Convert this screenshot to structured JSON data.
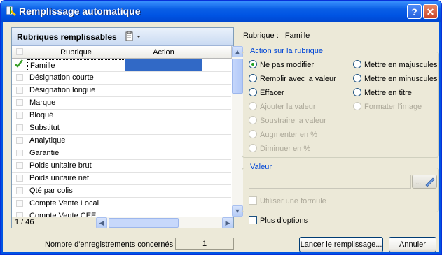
{
  "window": {
    "title": "Remplissage automatique",
    "help_label": "?",
    "close_label": "✕"
  },
  "grid": {
    "title": "Rubriques remplissables",
    "col_rubrique": "Rubrique",
    "col_action": "Action",
    "rows": [
      "Famille",
      "Désignation courte",
      "Désignation longue",
      "Marque",
      "Bloqué",
      "Substitut",
      "Analytique",
      "Garantie",
      "Poids unitaire brut",
      "Poids unitaire net",
      "Qté par colis",
      "Compte Vente Local",
      "Compte Vente CEE"
    ],
    "selected_index": 0,
    "pager": "1 / 46"
  },
  "rubrique": {
    "label": "Rubrique :",
    "value": "Famille"
  },
  "action": {
    "legend": "Action sur la rubrique",
    "ne_pas_modifier": "Ne pas modifier",
    "remplir": "Remplir avec la valeur",
    "effacer": "Effacer",
    "ajouter": "Ajouter la valeur",
    "soustraire": "Soustraire la valeur",
    "augmenter": "Augmenter en %",
    "diminuer": "Diminuer en %",
    "majuscules": "Mettre en majuscules",
    "minuscules": "Mettre en minuscules",
    "titre": "Mettre en titre",
    "formater": "Formater l'image",
    "selected": "ne_pas_modifier"
  },
  "valeur": {
    "legend": "Valeur",
    "formule_label": "Utiliser une formule"
  },
  "plus_options": "Plus d'options",
  "footer": {
    "count_label": "Nombre d'enregistrements concernés :",
    "count_value": "1",
    "launch_label": "Lancer le remplissage...",
    "cancel_label": "Annuler"
  },
  "colors": {
    "accent": "#0054e3",
    "selection": "#3169c6",
    "legend": "#0046d5"
  }
}
